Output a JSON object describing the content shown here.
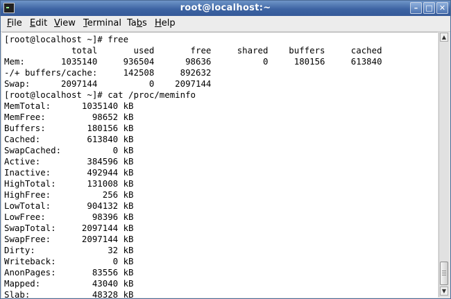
{
  "window": {
    "title": "root@localhost:~",
    "minimize_icon": "minimize-icon",
    "maximize_icon": "maximize-icon",
    "close_icon": "close-icon"
  },
  "menubar": {
    "items": [
      {
        "prefix": "",
        "accel": "F",
        "rest": "ile"
      },
      {
        "prefix": "",
        "accel": "E",
        "rest": "dit"
      },
      {
        "prefix": "",
        "accel": "V",
        "rest": "iew"
      },
      {
        "prefix": "",
        "accel": "T",
        "rest": "erminal"
      },
      {
        "prefix": "Ta",
        "accel": "b",
        "rest": "s"
      },
      {
        "prefix": "",
        "accel": "H",
        "rest": "elp"
      }
    ]
  },
  "terminal": {
    "lines": [
      "[root@localhost ~]# free",
      "             total       used       free     shared    buffers     cached",
      "Mem:       1035140     936504      98636          0     180156     613840",
      "-/+ buffers/cache:     142508     892632",
      "Swap:      2097144          0    2097144",
      "[root@localhost ~]# cat /proc/meminfo",
      "MemTotal:      1035140 kB",
      "MemFree:         98652 kB",
      "Buffers:        180156 kB",
      "Cached:         613840 kB",
      "SwapCached:          0 kB",
      "Active:         384596 kB",
      "Inactive:       492944 kB",
      "HighTotal:      131008 kB",
      "HighFree:          256 kB",
      "LowTotal:       904132 kB",
      "LowFree:         98396 kB",
      "SwapTotal:     2097144 kB",
      "SwapFree:      2097144 kB",
      "Dirty:              32 kB",
      "Writeback:           0 kB",
      "AnonPages:       83556 kB",
      "Mapped:          43040 kB",
      "Slab:            48328 kB"
    ]
  },
  "scrollbar": {
    "up_icon": "scroll-up-arrow-icon",
    "down_icon": "scroll-down-arrow-icon",
    "position": 0.95
  }
}
